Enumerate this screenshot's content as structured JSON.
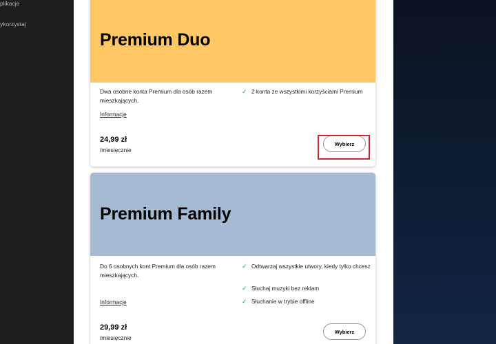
{
  "sidebar": {
    "items": [
      {
        "label": "plikacje"
      },
      {
        "label": "ykorzystaj"
      }
    ]
  },
  "plans": [
    {
      "title": "Premium Duo",
      "header_color": "#ffc864",
      "description": "Dwa osobne konta Premium dla osób razem mieszkających.",
      "info_link": "Informacje",
      "features": [
        "2 konta ze wszystkimi korzyściami Premium"
      ],
      "price": "24,99 zł",
      "period": "/miesięcznie",
      "button": "Wybierz"
    },
    {
      "title": "Premium Family",
      "header_color": "#a5bbd3",
      "description": "Do 6 osobnych kont Premium dla osób razem mieszkających.",
      "info_link": "Informacje",
      "features": [
        "Odtwarzaj wszystkie utwory, kiedy tylko chcesz",
        "Słuchaj muzyki bez reklam",
        "Słuchanie w trybie offline"
      ],
      "price": "29,99 zł",
      "period": "/miesięcznie",
      "button": "Wybierz"
    }
  ],
  "colors": {
    "highlight": "#d0212e",
    "check": "#1aa34a"
  }
}
